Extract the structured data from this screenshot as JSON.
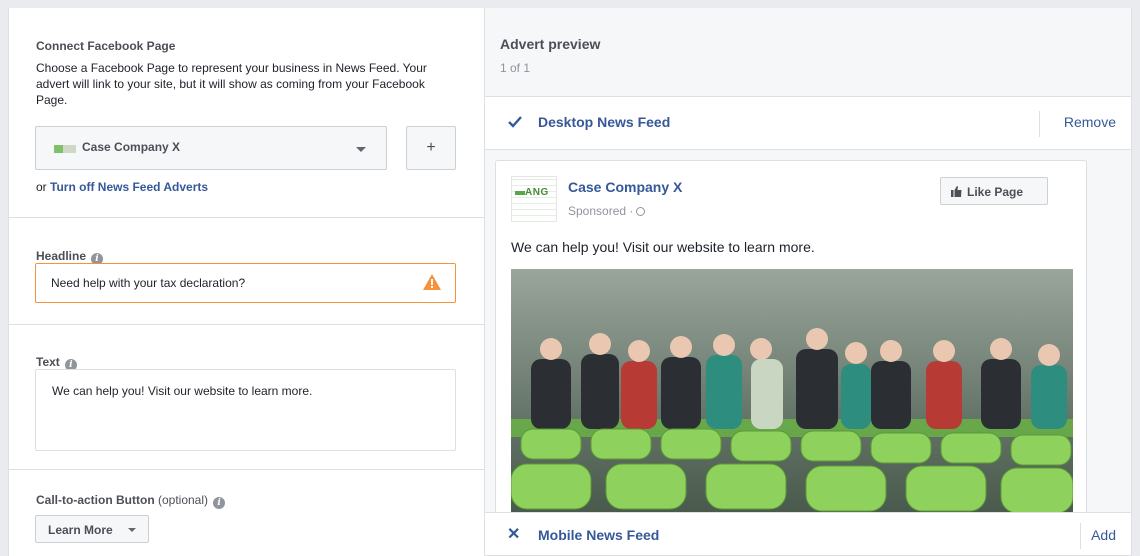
{
  "connect": {
    "title": "Connect Facebook Page",
    "description": "Choose a Facebook Page to represent your business in News Feed. Your advert will link to your site, but it will show as coming from your Facebook Page.",
    "selected_page": "Case Company X",
    "add_label": "+",
    "turnoff_prefix": "or ",
    "turnoff_link": "Turn off News Feed Adverts"
  },
  "headline": {
    "label": "Headline",
    "value": "Need help with your tax declaration?",
    "warning_color": "#f7923b"
  },
  "text": {
    "label": "Text",
    "value": "We can help you! Visit our website to learn more."
  },
  "cta": {
    "label": "Call-to-action Button",
    "optional": " (optional)",
    "selected": "Learn More"
  },
  "preview": {
    "title": "Advert preview",
    "count": "1 of 1",
    "desktop": {
      "label": "Desktop News Feed",
      "action": "Remove"
    },
    "mobile": {
      "label": "Mobile News Feed",
      "action": "Add"
    },
    "ad": {
      "logo_text": "ANG",
      "page_name": "Case Company X",
      "sponsored": "Sponsored ·",
      "like_label": "Like Page",
      "body": "We can help you! Visit our website to learn more."
    }
  },
  "colors": {
    "link": "#365899",
    "accent_green": "#7cc242"
  },
  "icons": [
    "info-icon",
    "warning-icon",
    "check-icon",
    "close-icon",
    "globe-icon",
    "thumbs-up-icon",
    "caret-down-icon"
  ]
}
